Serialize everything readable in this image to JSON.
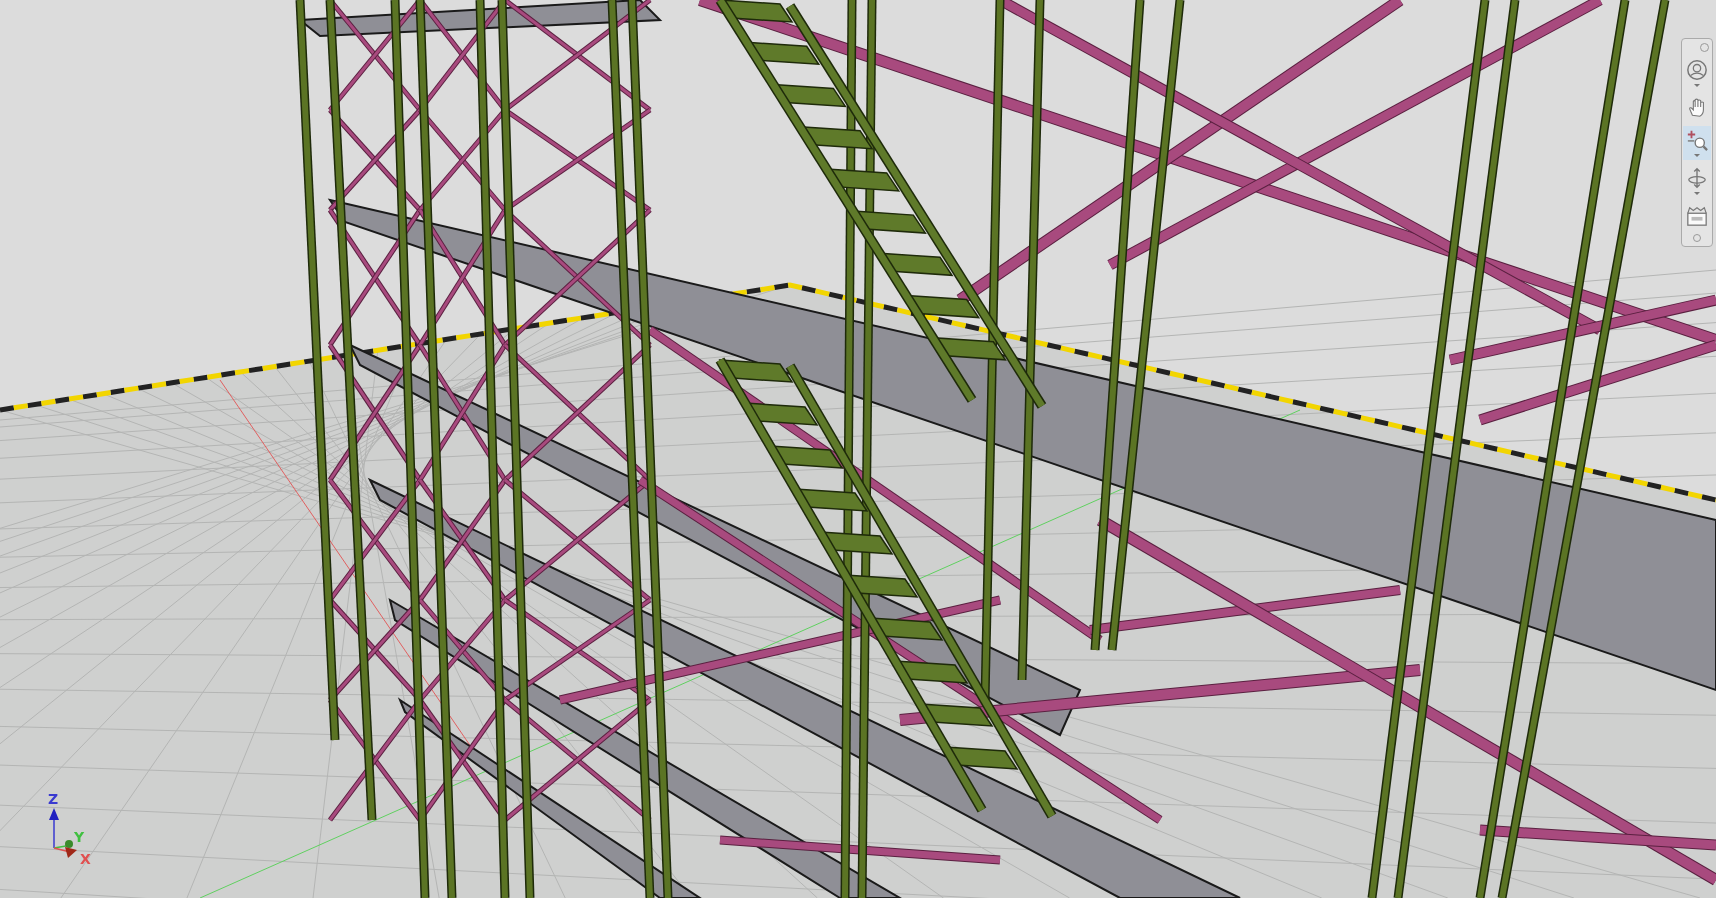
{
  "viewport": {
    "axis_labels": [
      {
        "label": "Z",
        "color": "#3a3ad0"
      },
      {
        "label": "Y",
        "color": "#40c040"
      },
      {
        "label": "X",
        "color": "#e05050"
      }
    ]
  },
  "navigation_bar": {
    "tools": [
      {
        "kind": "wheel",
        "selected": false,
        "has_menu": true
      },
      {
        "kind": "pan",
        "selected": false,
        "has_menu": false
      },
      {
        "kind": "zoom",
        "selected": true,
        "has_menu": true
      },
      {
        "kind": "orbit",
        "selected": false,
        "has_menu": true
      },
      {
        "kind": "showmotion",
        "selected": false,
        "has_menu": false
      }
    ]
  }
}
